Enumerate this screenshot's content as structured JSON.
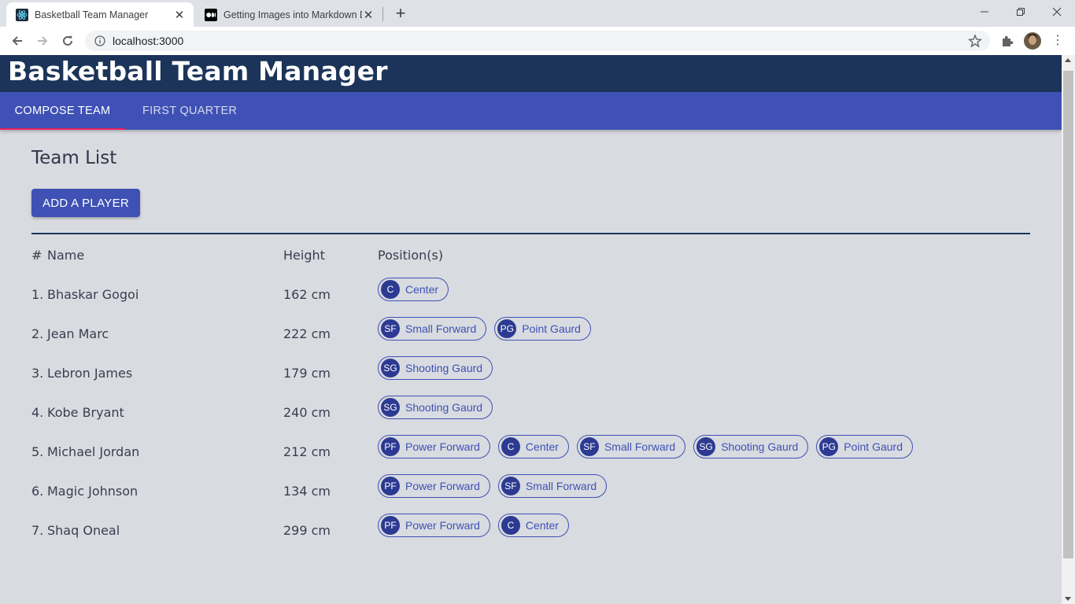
{
  "browser": {
    "tabs": [
      {
        "title": "Basketball Team Manager",
        "active": true
      },
      {
        "title": "Getting Images into Markdown D",
        "active": false
      }
    ],
    "url": "localhost:3000"
  },
  "app": {
    "title": "Basketball Team Manager",
    "nav_tabs": [
      "COMPOSE TEAM",
      "FIRST QUARTER"
    ],
    "active_tab": "COMPOSE TEAM",
    "accent_color": "#3f51b5",
    "header_color": "#1c3459",
    "indicator_color": "#e91e63"
  },
  "team_list": {
    "title": "Team List",
    "add_button_label": "ADD A PLAYER",
    "columns": {
      "num": "#",
      "name": "Name",
      "height": "Height",
      "positions": "Position(s)"
    },
    "players": [
      {
        "num": "1.",
        "name": "Bhaskar Gogoi",
        "height": "162 cm",
        "positions": [
          {
            "abbr": "C",
            "label": "Center"
          }
        ]
      },
      {
        "num": "2.",
        "name": "Jean Marc",
        "height": "222 cm",
        "positions": [
          {
            "abbr": "SF",
            "label": "Small Forward"
          },
          {
            "abbr": "PG",
            "label": "Point Gaurd"
          }
        ]
      },
      {
        "num": "3.",
        "name": "Lebron James",
        "height": "179 cm",
        "positions": [
          {
            "abbr": "SG",
            "label": "Shooting Gaurd"
          }
        ]
      },
      {
        "num": "4.",
        "name": "Kobe Bryant",
        "height": "240 cm",
        "positions": [
          {
            "abbr": "SG",
            "label": "Shooting Gaurd"
          }
        ]
      },
      {
        "num": "5.",
        "name": "Michael Jordan",
        "height": "212 cm",
        "positions": [
          {
            "abbr": "PF",
            "label": "Power Forward"
          },
          {
            "abbr": "C",
            "label": "Center"
          },
          {
            "abbr": "SF",
            "label": "Small Forward"
          },
          {
            "abbr": "SG",
            "label": "Shooting Gaurd"
          },
          {
            "abbr": "PG",
            "label": "Point Gaurd"
          }
        ]
      },
      {
        "num": "6.",
        "name": "Magic Johnson",
        "height": "134 cm",
        "positions": [
          {
            "abbr": "PF",
            "label": "Power Forward"
          },
          {
            "abbr": "SF",
            "label": "Small Forward"
          }
        ]
      },
      {
        "num": "7.",
        "name": "Shaq Oneal",
        "height": "299 cm",
        "positions": [
          {
            "abbr": "PF",
            "label": "Power Forward"
          },
          {
            "abbr": "C",
            "label": "Center"
          }
        ]
      }
    ]
  }
}
